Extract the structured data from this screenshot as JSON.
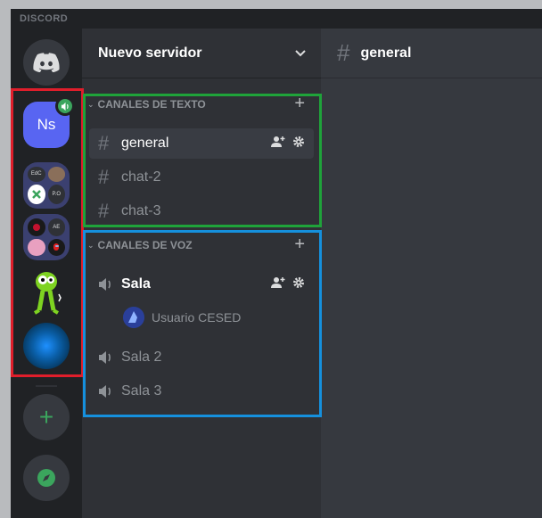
{
  "app": {
    "title": "DISCORD"
  },
  "colors": {
    "accent": "#5865f2",
    "green": "#3ba55d",
    "highlight_red": "#e01e2b",
    "highlight_green": "#1fa33a",
    "highlight_blue": "#1590dd"
  },
  "servers": {
    "home_icon": "discord-logo-icon",
    "ns": {
      "label": "Ns"
    },
    "folder1": [
      "EdC",
      "",
      "",
      "P.O"
    ],
    "folder2": [
      "",
      "AE",
      "",
      ""
    ],
    "add_label": "+",
    "explore_icon": "compass-icon"
  },
  "server_header": {
    "name": "Nuevo servidor"
  },
  "text_category": {
    "label": "CANALES DE TEXTO"
  },
  "text_channels": [
    {
      "name": "general"
    },
    {
      "name": "chat-2"
    },
    {
      "name": "chat-3"
    }
  ],
  "voice_category": {
    "label": "CANALES DE VOZ"
  },
  "voice_channels": [
    {
      "name": "Sala",
      "users": [
        {
          "name": "Usuario CESED"
        }
      ]
    },
    {
      "name": "Sala 2"
    },
    {
      "name": "Sala 3"
    }
  ],
  "main": {
    "channel": "general"
  }
}
